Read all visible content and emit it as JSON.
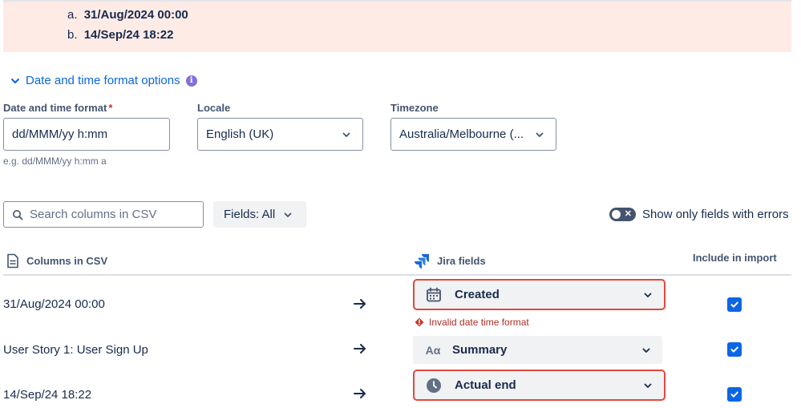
{
  "error_list": {
    "items": [
      {
        "marker": "a.",
        "value": "31/Aug/2024 00:00"
      },
      {
        "marker": "b.",
        "value": "14/Sep/24 18:22"
      }
    ]
  },
  "format_options": {
    "toggle_label": "Date and time format options",
    "info_icon": "i",
    "datetime_format": {
      "label": "Date and time format",
      "required_marker": "*",
      "value": "dd/MMM/yy h:mm",
      "helper": "e.g. dd/MMM/yy h:mm a"
    },
    "locale": {
      "label": "Locale",
      "value": "English (UK)"
    },
    "timezone": {
      "label": "Timezone",
      "value": "Australia/Melbourne (..."
    }
  },
  "toolbar": {
    "search_placeholder": "Search columns in CSV",
    "fields_filter": "Fields: All",
    "toggle_label": "Show only fields with errors",
    "toggle_on": false
  },
  "table": {
    "headers": {
      "csv": "Columns in CSV",
      "jira": "Jira fields",
      "include": "Include in import"
    },
    "rows": [
      {
        "csv": "31/Aug/2024 00:00",
        "field": "Created",
        "icon": "calendar-icon",
        "error": true,
        "error_text": "Invalid date time format",
        "included": true
      },
      {
        "csv": "User Story 1: User Sign Up",
        "field": "Summary",
        "icon": "text-field-icon",
        "icon_text": "Aα",
        "error": false,
        "included": true
      },
      {
        "csv": "14/Sep/24 18:22",
        "field": "Actual end",
        "icon": "clock-icon",
        "error": true,
        "included": true
      }
    ]
  },
  "colors": {
    "link": "#0c66e4",
    "error": "#e2483d",
    "banner_bg": "#ffebe6",
    "checkbox": "#0c66e4"
  }
}
